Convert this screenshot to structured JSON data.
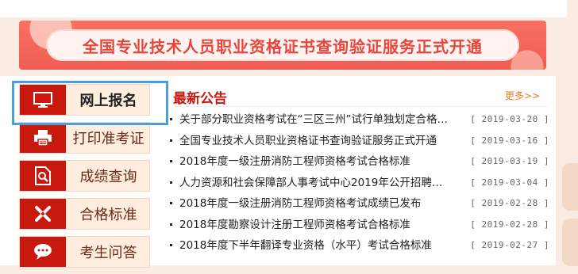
{
  "banner": {
    "text": "全国专业技术人员职业资格证书查询验证服务正式开通"
  },
  "menu": {
    "items": [
      {
        "label": "网上报名",
        "icon": "monitor-icon"
      },
      {
        "label": "打印准考证",
        "icon": "printer-icon"
      },
      {
        "label": "成绩查询",
        "icon": "search-document-icon"
      },
      {
        "label": "合格标准",
        "icon": "tools-icon"
      },
      {
        "label": "考生问答",
        "icon": "chat-bubble-icon"
      }
    ]
  },
  "news": {
    "title": "最新公告",
    "more": "更多>>",
    "items": [
      {
        "text": "关于部分职业资格考试在“三区三州”试行单独划定合格…",
        "date": "[ 2019-03-20 ]"
      },
      {
        "text": "全国专业技术人员职业资格证书查询验证服务正式开通",
        "date": "[ 2019-03-16 ]"
      },
      {
        "text": "2018年度一级注册消防工程师资格考试合格标准",
        "date": "[ 2019-03-19 ]"
      },
      {
        "text": "人力资源和社会保障部人事考试中心2019年公开招聘…",
        "date": "[ 2019-03-04 ]"
      },
      {
        "text": "2018年度一级注册消防工程师资格考试成绩已发布",
        "date": "[ 2019-02-28 ]"
      },
      {
        "text": "2018年度勘察设计注册工程师资格考试合格标准",
        "date": "[ 2019-02-28 ]"
      },
      {
        "text": "2018年度下半年翻译专业资格（水平）考试合格标准",
        "date": "[ 2019-02-27 ]"
      }
    ]
  },
  "colors": {
    "brand_red": "#c9180e",
    "banner_red": "#f26a5c",
    "selection_blue": "#4a9fe0",
    "more_orange": "#e67e1e"
  }
}
